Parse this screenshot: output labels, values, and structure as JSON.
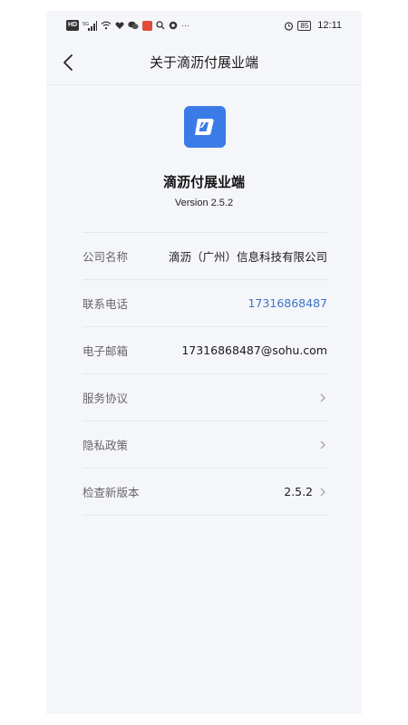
{
  "status_bar": {
    "left_icons": [
      "hd-icon",
      "5g-signal-icon",
      "wifi-icon",
      "heart-icon",
      "wechat-icon",
      "app-badge-icon",
      "search-icon",
      "browser-icon",
      "more-dots-icon"
    ],
    "hd_label": "HD",
    "more_label": "···",
    "battery": "85",
    "time": "12:11"
  },
  "nav": {
    "title": "关于滴沥付展业端"
  },
  "app": {
    "name": "滴沥付展业端",
    "version": "Version 2.5.2",
    "logo_color": "#3a7be8"
  },
  "rows": [
    {
      "label": "公司名称",
      "value": "滴沥（广州）信息科技有限公司",
      "chevron": false,
      "link": false
    },
    {
      "label": "联系电话",
      "value": "17316868487",
      "chevron": false,
      "link": true
    },
    {
      "label": "电子邮箱",
      "value": "17316868487@sohu.com",
      "chevron": false,
      "link": false
    },
    {
      "label": "服务协议",
      "value": "",
      "chevron": true,
      "link": false
    },
    {
      "label": "隐私政策",
      "value": "",
      "chevron": true,
      "link": false
    },
    {
      "label": "检查新版本",
      "value": "2.5.2",
      "chevron": true,
      "link": false
    }
  ],
  "colors": {
    "background": "#f5f6fa",
    "accent": "#3a7be8",
    "link": "#3a74c9"
  }
}
